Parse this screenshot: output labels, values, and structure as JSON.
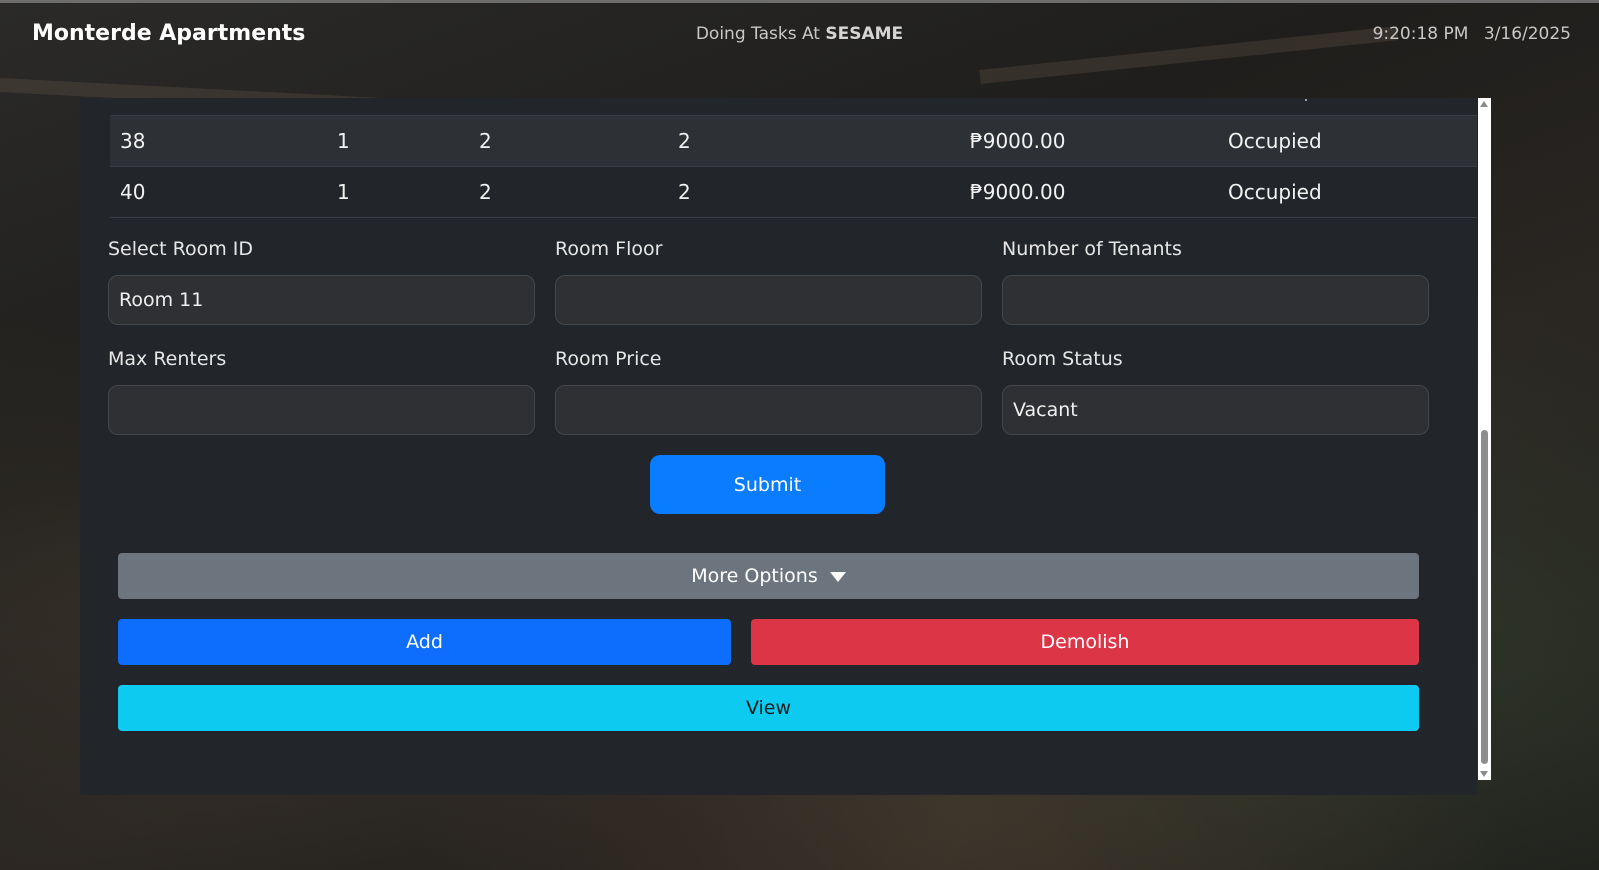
{
  "header": {
    "app_title": "Monterde Apartments",
    "task_prefix": "Doing Tasks At",
    "task_location": "SESAME",
    "time": "9:20:18 PM",
    "date": "3/16/2025"
  },
  "table": {
    "rows": [
      {
        "id": "38",
        "floor": "1",
        "tenants": "2",
        "max": "2",
        "price": "₱9000.00",
        "status": "Occupied"
      },
      {
        "id": "40",
        "floor": "1",
        "tenants": "2",
        "max": "2",
        "price": "₱9000.00",
        "status": "Occupied"
      }
    ]
  },
  "form": {
    "room_id_label": "Select Room ID",
    "room_id_value": "Room 11",
    "room_floor_label": "Room Floor",
    "room_floor_value": "",
    "tenants_label": "Number of Tenants",
    "tenants_value": "",
    "max_renters_label": "Max Renters",
    "max_renters_value": "",
    "room_price_label": "Room Price",
    "room_price_value": "",
    "room_status_label": "Room Status",
    "room_status_value": "Vacant",
    "submit_label": "Submit"
  },
  "actions": {
    "more_options_label": "More Options",
    "add_label": "Add",
    "demolish_label": "Demolish",
    "view_label": "View"
  },
  "colors": {
    "primary": "#0a7cff",
    "add": "#0d6efd",
    "danger": "#dc3545",
    "info": "#0dcaf0",
    "secondary": "#6c757d",
    "panel": "#22252a"
  },
  "icons": {
    "more_options_caret": "caret-down-icon",
    "scroll_up": "scroll-up-arrow-icon",
    "scroll_down": "scroll-down-arrow-icon"
  }
}
